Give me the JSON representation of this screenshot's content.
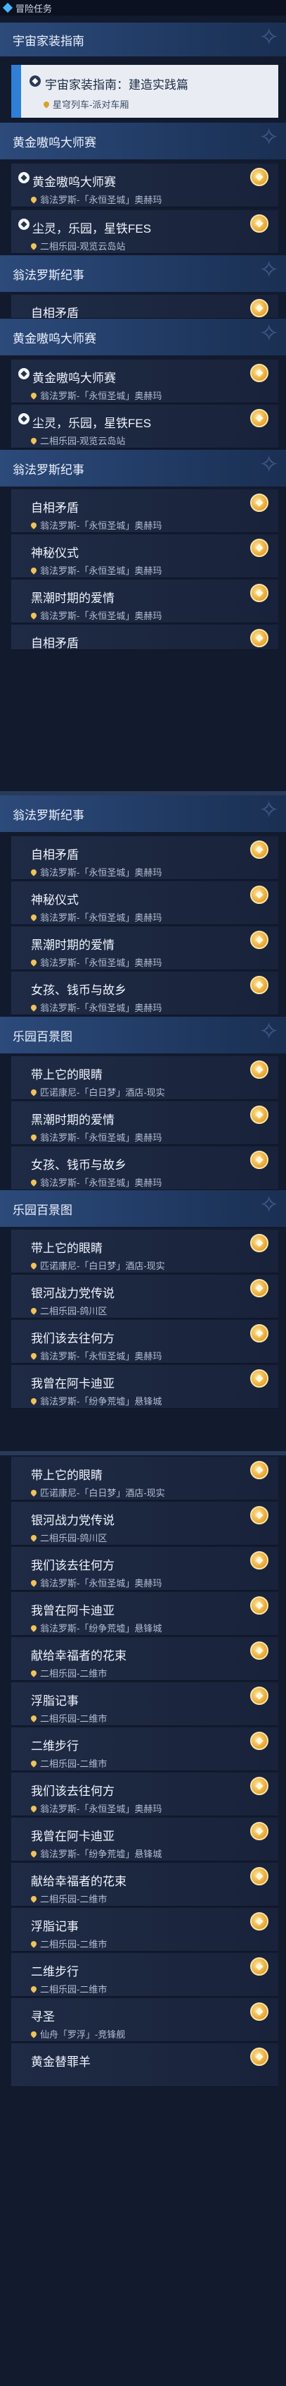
{
  "header": {
    "title": "冒险任务"
  },
  "sections": [
    {
      "label": "宇宙家装指南"
    },
    {
      "label": "黄金嗷呜大师赛"
    },
    {
      "label": "翁法罗斯纪事"
    },
    {
      "label": "乐园百景图"
    }
  ],
  "quests": [
    {
      "title": "宇宙家装指南：建造实践篇",
      "location": "星穹列车-派对车厢"
    },
    {
      "title": "黄金嗷呜大师赛",
      "location": "翁法罗斯-「永恒圣城」奥赫玛"
    },
    {
      "title": "尘灵，乐园，星铁FES",
      "location": "二相乐园-观览云岛站"
    },
    {
      "title": "自相矛盾",
      "location": "翁法罗斯-「永恒圣城」奥赫玛"
    },
    {
      "title": "神秘仪式",
      "location": "翁法罗斯-「永恒圣城」奥赫玛"
    },
    {
      "title": "黑潮时期的爱情",
      "location": "翁法罗斯-「永恒圣城」奥赫玛"
    },
    {
      "title": "女孩、钱币与故乡",
      "location": "翁法罗斯-「永恒圣城」奥赫玛"
    },
    {
      "title": "带上它的眼睛",
      "location": "匹诺康尼-「白日梦」酒店-现实"
    },
    {
      "title": "银河战力党传说",
      "location": "二相乐园-鸽川区"
    },
    {
      "title": "我们该去往何方",
      "location": "翁法罗斯-「永恒圣城」奥赫玛"
    },
    {
      "title": "我曾在阿卡迪亚",
      "location": "翁法罗斯-「纷争荒墟」悬锋城"
    },
    {
      "title": "献给幸福者的花束",
      "location": "二相乐园-二维市"
    },
    {
      "title": "浮脂记事",
      "location": "二相乐园-二维市"
    },
    {
      "title": "二维步行",
      "location": "二相乐园-二维市"
    },
    {
      "title": "寻圣",
      "location": "仙舟「罗浮」-竞锋舰"
    },
    {
      "title": "黄金替罪羊",
      "location": ""
    }
  ]
}
